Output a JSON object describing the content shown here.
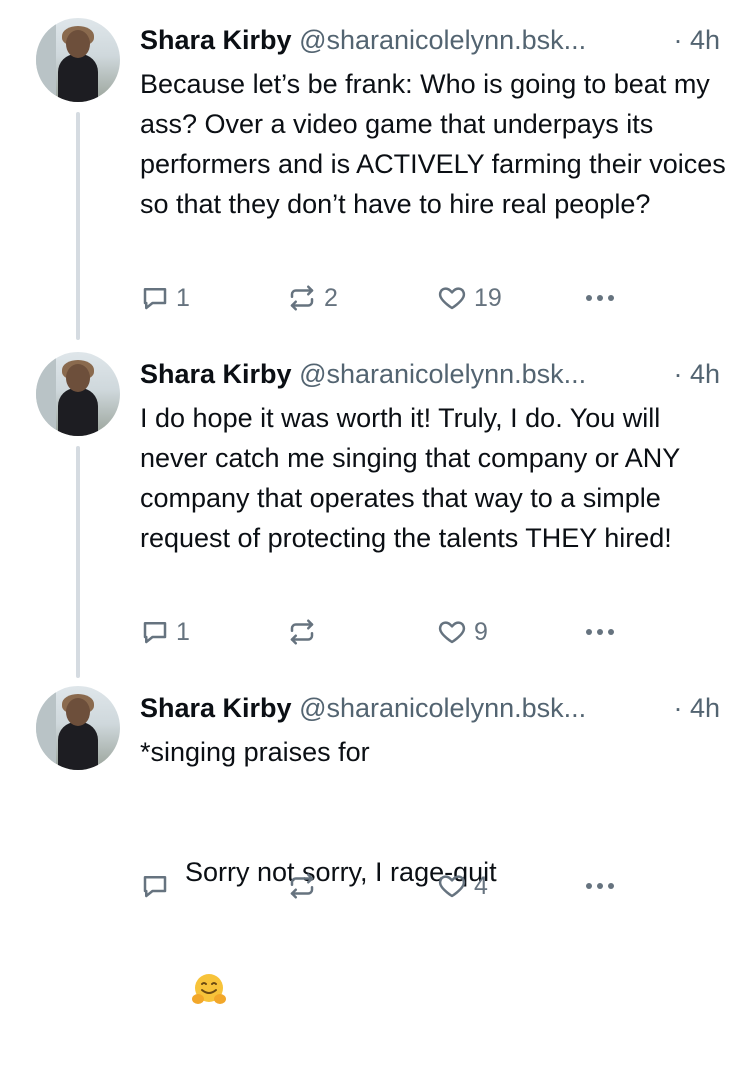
{
  "posts": [
    {
      "author": "Shara Kirby",
      "handle": "@sharanicolelynn.bsk...",
      "time": "· 4h",
      "text": "Because let’s be frank: Who is going to beat my ass? Over a video game that underpays its performers and is ACTIVELY farming their voices so that they don’t have to hire real people?",
      "replies": "1",
      "reposts": "2",
      "likes": "19"
    },
    {
      "author": "Shara Kirby",
      "handle": "@sharanicolelynn.bsk...",
      "time": "· 4h",
      "text": "I do hope it was worth it! Truly, I do. You will never catch me singing that company or ANY company that operates that way to a simple request of protecting the talents THEY hired!",
      "replies": "1",
      "reposts": "",
      "likes": "9"
    },
    {
      "author": "Shara Kirby",
      "handle": "@sharanicolelynn.bsk...",
      "time": "· 4h",
      "text_line1": "*singing praises for",
      "text_line2": "Sorry not sorry, I rage-quit",
      "emoji": "hugging-face-emoji",
      "replies": "",
      "reposts": "",
      "likes": "4"
    }
  ],
  "icons": {
    "reply": "reply-icon",
    "repost": "repost-icon",
    "like": "heart-icon",
    "more": "more-icon"
  },
  "colors": {
    "text": "#0b0f14",
    "muted": "#536471",
    "icon": "#66737f",
    "thread_line": "#d5dbe1"
  }
}
